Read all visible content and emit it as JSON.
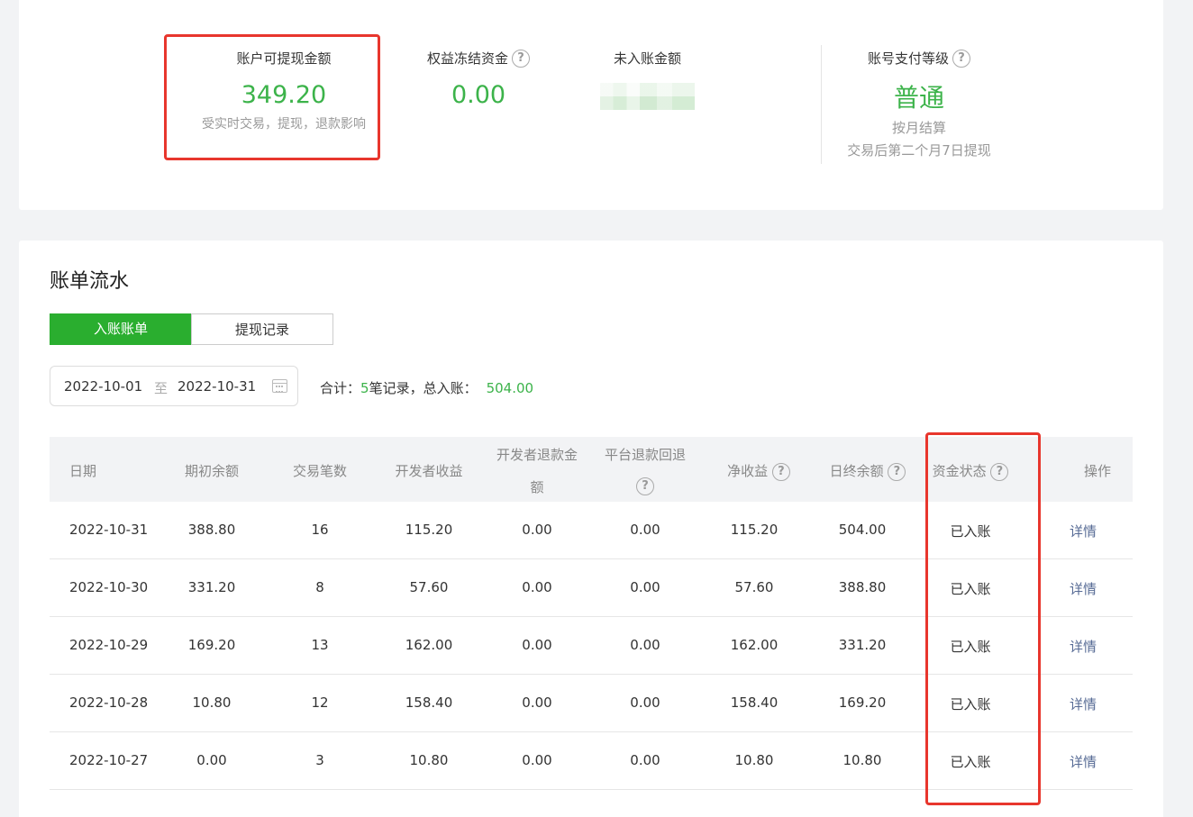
{
  "stats": {
    "withdrawable": {
      "label": "账户可提现金额",
      "value": "349.20",
      "note": "受实时交易，提现，退款影响"
    },
    "frozen": {
      "label": "权益冻结资金",
      "value": "0.00"
    },
    "pending": {
      "label": "未入账金额"
    },
    "level": {
      "label": "账号支付等级",
      "value": "普通",
      "note1": "按月结算",
      "note2": "交易后第二个月7日提现"
    }
  },
  "bill": {
    "title": "账单流水",
    "tabs": [
      "入账账单",
      "提现记录"
    ],
    "date_start": "2022-10-01",
    "date_sep": "至",
    "date_end": "2022-10-31",
    "summary_prefix": "合计：",
    "summary_count": "5",
    "summary_mid": "笔记录，总入账：",
    "summary_total": "504.00"
  },
  "table": {
    "headers": [
      "日期",
      "期初余额",
      "交易笔数",
      "开发者收益",
      "开发者退款金",
      "额",
      "平台退款回退",
      "净收益",
      "日终余额",
      "资金状态",
      "操作"
    ],
    "rows": [
      {
        "date": "2022-10-31",
        "open": "388.80",
        "count": "16",
        "income": "115.20",
        "dev_refund": "0.00",
        "plat_refund": "0.00",
        "net": "115.20",
        "close": "504.00",
        "status": "已入账",
        "action": "详情"
      },
      {
        "date": "2022-10-30",
        "open": "331.20",
        "count": "8",
        "income": "57.60",
        "dev_refund": "0.00",
        "plat_refund": "0.00",
        "net": "57.60",
        "close": "388.80",
        "status": "已入账",
        "action": "详情"
      },
      {
        "date": "2022-10-29",
        "open": "169.20",
        "count": "13",
        "income": "162.00",
        "dev_refund": "0.00",
        "plat_refund": "0.00",
        "net": "162.00",
        "close": "331.20",
        "status": "已入账",
        "action": "详情"
      },
      {
        "date": "2022-10-28",
        "open": "10.80",
        "count": "12",
        "income": "158.40",
        "dev_refund": "0.00",
        "plat_refund": "0.00",
        "net": "158.40",
        "close": "169.20",
        "status": "已入账",
        "action": "详情"
      },
      {
        "date": "2022-10-27",
        "open": "0.00",
        "count": "3",
        "income": "10.80",
        "dev_refund": "0.00",
        "plat_refund": "0.00",
        "net": "10.80",
        "close": "10.80",
        "status": "已入账",
        "action": "详情"
      }
    ]
  },
  "colors": {
    "accent": "#3cb34a",
    "tab_active": "#2aae2f",
    "highlight": "#e8362d",
    "link": "#576b95"
  },
  "icons": [
    "help-icon",
    "calendar-icon"
  ]
}
